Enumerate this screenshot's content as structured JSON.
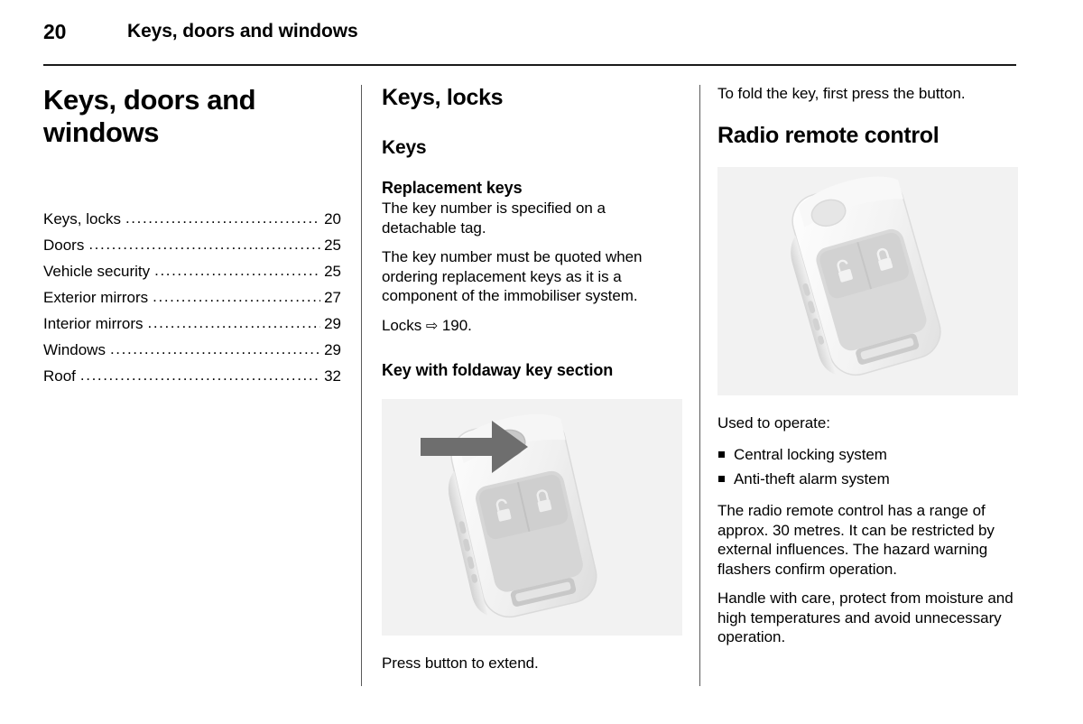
{
  "header": {
    "page_number": "20",
    "title": "Keys, doors and windows"
  },
  "left_column": {
    "chapter_title": "Keys, doors and\nwindows",
    "toc": {
      "dot_leader": "....................................................",
      "entries": [
        {
          "label": "Keys, locks",
          "page": "20"
        },
        {
          "label": "Doors",
          "page": "25"
        },
        {
          "label": "Vehicle security",
          "page": "25"
        },
        {
          "label": "Exterior mirrors",
          "page": "27"
        },
        {
          "label": "Interior mirrors",
          "page": "29"
        },
        {
          "label": "Windows",
          "page": "29"
        },
        {
          "label": "Roof",
          "page": "32"
        }
      ]
    }
  },
  "middle_column": {
    "section_title": "Keys, locks",
    "subsection_title": "Keys",
    "topic_title": "Replacement keys",
    "paragraph_1": "The key number is specified on a detachable tag.",
    "paragraph_2": "The key number must be quoted when ordering replacement keys as it is a component of the immobiliser system.",
    "cross_reference_label": "Locks",
    "cross_reference_arrow": "⇨",
    "cross_reference_page": "190.",
    "figure_heading": "Key with foldaway key section",
    "figure_caption": "Press button to extend."
  },
  "right_column": {
    "paragraph_1": "To fold the key, first press the button.",
    "section_title": "Radio remote control",
    "list_intro": "Used to operate:",
    "bullets": [
      "Central locking system",
      "Anti-theft alarm system"
    ],
    "paragraph_2": "The radio remote control has a range of approx. 30 metres. It can be restricted by external influences. The hazard warning flashers confirm operation.",
    "paragraph_3": "Handle with care, protect from moisture and high temperatures and avoid unnecessary operation."
  },
  "colors": {
    "text": "#000000",
    "rule": "#1a1a1a",
    "divider": "#5a5a5a",
    "figure_background": "#f2f2f2",
    "arrow_callout": "#6e6e6e",
    "key_body_light": "#f7f7f7",
    "key_body_shade": "#e3e3e3",
    "key_button_pad": "#d9d9d9"
  },
  "figures": {
    "key_foldaway": {
      "name": "key-with-foldaway-section-illustration",
      "callout": "arrow-pointing-to-release-button",
      "button_icons": [
        "unlock-padlock-icon",
        "lock-padlock-icon"
      ]
    },
    "radio_remote": {
      "name": "radio-remote-control-illustration",
      "button_icons": [
        "unlock-padlock-icon",
        "lock-padlock-icon"
      ]
    }
  }
}
